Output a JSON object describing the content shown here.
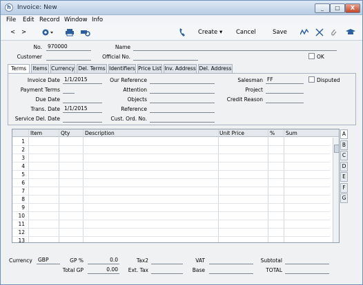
{
  "window": {
    "title": "Invoice: New",
    "min": "_",
    "max": "□",
    "close": "X"
  },
  "menu": [
    "File",
    "Edit",
    "Record",
    "Window",
    "Info"
  ],
  "toolbar": {
    "back": "<",
    "forward": ">",
    "create": "Create",
    "cancel": "Cancel",
    "save": "Save"
  },
  "header": {
    "no_label": "No.",
    "no_value": "970000",
    "name_label": "Name",
    "name_value": "",
    "customer_label": "Customer",
    "customer_value": "",
    "official_label": "Official No.",
    "official_value": "",
    "ok_label": "OK"
  },
  "tabs": [
    "Terms",
    "Items",
    "Currency",
    "Del. Terms",
    "Identifiers",
    "Price List",
    "Inv. Address",
    "Del. Address"
  ],
  "terms": {
    "invoice_date_label": "Invoice Date",
    "invoice_date": "1/1/2015",
    "payment_terms_label": "Payment Terms",
    "payment_terms": "",
    "due_date_label": "Due Date",
    "due_date": "",
    "trans_date_label": "Trans. Date",
    "trans_date": "1/1/2015",
    "service_label": "Service Del. Date",
    "service": "",
    "our_ref_label": "Our Reference",
    "our_ref": "",
    "attention_label": "Attention",
    "attention": "",
    "objects_label": "Objects",
    "objects": "",
    "reference_label": "Reference",
    "reference": "",
    "cust_ord_label": "Cust. Ord. No.",
    "cust_ord": "",
    "salesman_label": "Salesman",
    "salesman": "FF",
    "disputed_label": "Disputed",
    "project_label": "Project",
    "project": "",
    "credit_label": "Credit Reason",
    "credit": ""
  },
  "grid": {
    "headers": [
      "Item",
      "Qty",
      "Description",
      "Unit Price",
      "%",
      "Sum"
    ],
    "rows": [
      "1",
      "2",
      "3",
      "4",
      "5",
      "6",
      "7",
      "8",
      "9",
      "10",
      "11",
      "12",
      "13"
    ]
  },
  "side_tabs": [
    "A",
    "B",
    "C",
    "D",
    "E",
    "F",
    "G"
  ],
  "footer": {
    "currency_label": "Currency",
    "currency": "GBP",
    "gp_label": "GP %",
    "gp": "0.0",
    "tax2_label": "Tax2",
    "tax2": "",
    "vat_label": "VAT",
    "vat": "",
    "subtotal_label": "Subtotal",
    "subtotal": "",
    "totalgp_label": "Total GP",
    "totalgp": "0.00",
    "exttax_label": "Ext. Tax",
    "exttax": "",
    "base_label": "Base",
    "base": "",
    "total_label": "TOTAL",
    "total": ""
  }
}
